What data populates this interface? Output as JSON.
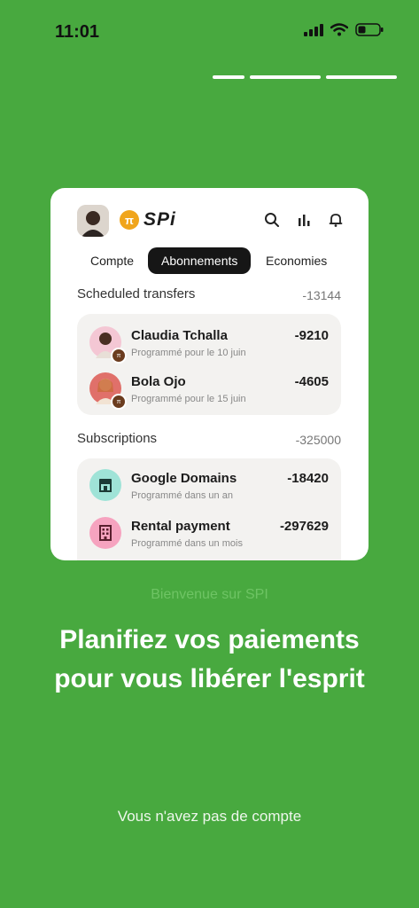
{
  "status_bar": {
    "time": "11:01"
  },
  "colors": {
    "background": "#48a93f",
    "accent": "#f0a51c",
    "tab_active": "#161616"
  },
  "card": {
    "logo_text": "SPi",
    "tabs": [
      {
        "label": "Compte"
      },
      {
        "label": "Abonnements",
        "active": true
      },
      {
        "label": "Economies"
      }
    ],
    "scheduled": {
      "title": "Scheduled transfers",
      "total": "-13144",
      "items": [
        {
          "name": "Claudia Tchalla",
          "sub": "Programmé pour le 10 juin",
          "amount": "-9210"
        },
        {
          "name": "Bola Ojo",
          "sub": "Programmé pour le 15 juin",
          "amount": "-4605"
        }
      ]
    },
    "subscriptions": {
      "title": "Subscriptions",
      "total": "-325000",
      "items": [
        {
          "name": "Google Domains",
          "sub": "Programmé dans un an",
          "amount": "-18420",
          "icon": "storefront-icon"
        },
        {
          "name": "Rental payment",
          "sub": "Programmé dans un mois",
          "amount": "-297629",
          "icon": "building-icon"
        }
      ]
    }
  },
  "welcome": "Bienvenue sur SPI",
  "headline": {
    "line1": "Planifiez vos paiements",
    "line2": "pour vous libérer l'esprit"
  },
  "no_account": "Vous n'avez pas de compte"
}
